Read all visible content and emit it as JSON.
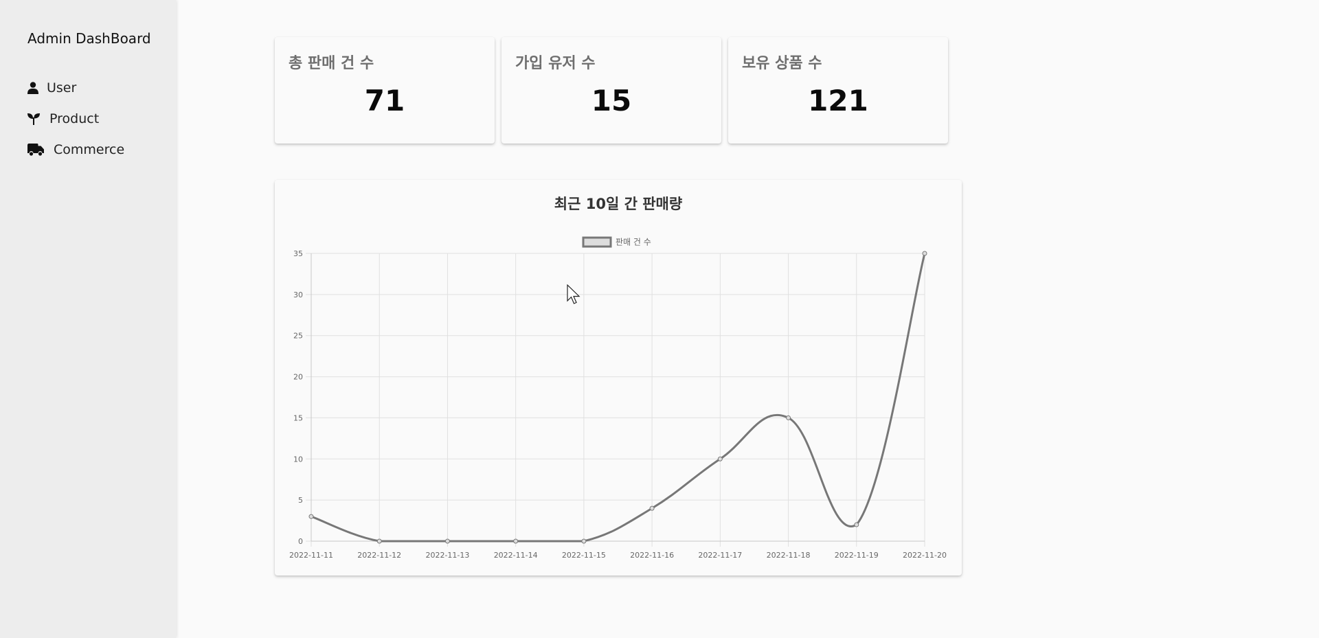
{
  "sidebar": {
    "brand": "Admin DashBoard",
    "items": [
      {
        "label": "User",
        "icon": "person-icon"
      },
      {
        "label": "Product",
        "icon": "seedling-icon"
      },
      {
        "label": "Commerce",
        "icon": "truck-icon"
      }
    ]
  },
  "stats": [
    {
      "title": "총 판매 건 수",
      "value": "71"
    },
    {
      "title": "가입 유저 수",
      "value": "15"
    },
    {
      "title": "보유 상품 수",
      "value": "121"
    }
  ],
  "colors": {
    "line": "#777777",
    "grid": "#e0e0e0",
    "legend_fill": "#dddddd"
  },
  "chart_data": {
    "type": "line",
    "title": "최근 10일 간 판매량",
    "categories": [
      "2022-11-11",
      "2022-11-12",
      "2022-11-13",
      "2022-11-14",
      "2022-11-15",
      "2022-11-16",
      "2022-11-17",
      "2022-11-18",
      "2022-11-19",
      "2022-11-20"
    ],
    "series": [
      {
        "name": "판매 건 수",
        "values": [
          3,
          0,
          0,
          0,
          0,
          4,
          10,
          15,
          2,
          35
        ]
      }
    ],
    "ylim": [
      0,
      35
    ],
    "yticks": [
      0,
      5,
      10,
      15,
      20,
      25,
      30,
      35
    ],
    "grid": true,
    "legend": "top",
    "smooth": true
  }
}
